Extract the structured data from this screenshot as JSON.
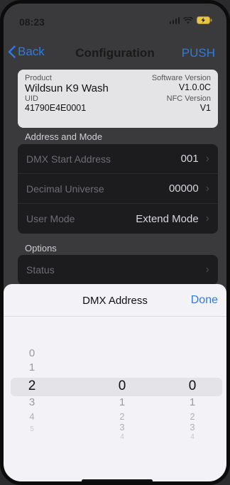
{
  "status_bar": {
    "time": "08:23"
  },
  "nav": {
    "back_label": "Back",
    "title": "Configuration",
    "action_label": "PUSH"
  },
  "product": {
    "product_label": "Product",
    "product_value": "Wildsun K9 Wash",
    "software_label": "Software Version",
    "software_value": "V1.0.0C",
    "uid_label": "UID",
    "uid_value": "41790E4E0001",
    "nfc_label": "NFC Version",
    "nfc_value": "V1"
  },
  "address_section": {
    "title": "Address and Mode",
    "rows": [
      {
        "label": "DMX Start Address",
        "value": "001"
      },
      {
        "label": "Decimal Universe",
        "value": "00000"
      },
      {
        "label": "User Mode",
        "value": "Extend Mode"
      }
    ]
  },
  "options_section": {
    "title": "Options",
    "rows": [
      {
        "label": "Status",
        "value": ""
      }
    ]
  },
  "picker": {
    "title": "DMX Address",
    "done_label": "Done",
    "columns": [
      {
        "items": [
          "0",
          "1",
          "2",
          "3",
          "4",
          "5"
        ],
        "selected_index": 2
      },
      {
        "items": [
          "0",
          "1",
          "2",
          "3",
          "4"
        ],
        "selected_index": 0
      },
      {
        "items": [
          "0",
          "1",
          "2",
          "3",
          "4"
        ],
        "selected_index": 0
      }
    ]
  }
}
